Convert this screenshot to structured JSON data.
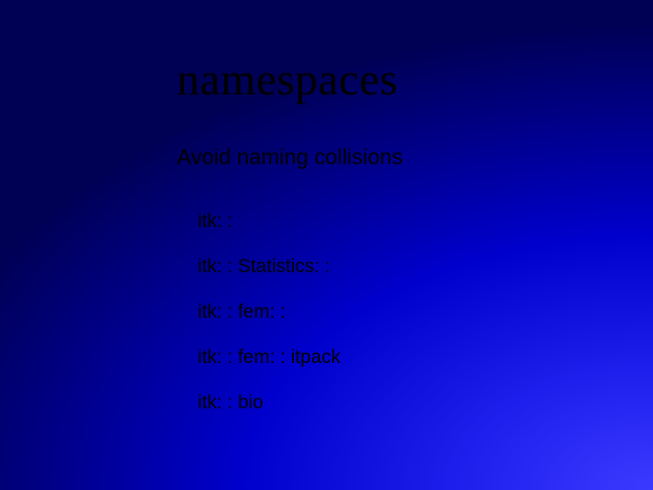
{
  "slide": {
    "title": "namespaces",
    "subtitle": "Avoid naming collisions",
    "items": [
      "itk: :",
      "itk: : Statistics: :",
      "itk: : fem: :",
      "itk: : fem: : itpack",
      "itk: : bio"
    ]
  }
}
